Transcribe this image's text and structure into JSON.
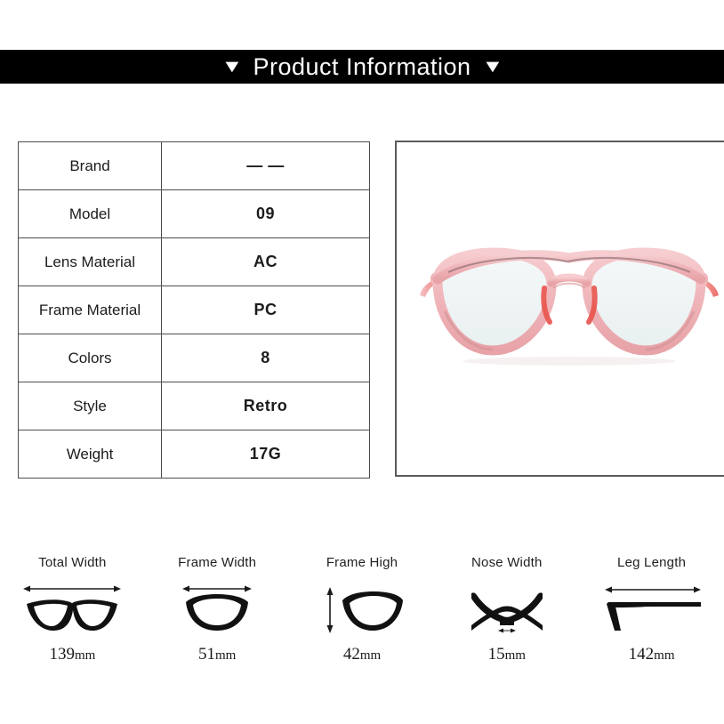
{
  "banner": {
    "title": "Product Information",
    "left_marker": "▼",
    "right_marker": "▼",
    "background_color": "#000000",
    "text_color": "#ffffff"
  },
  "spec_table": {
    "rows": [
      {
        "label": "Brand",
        "value": "— —"
      },
      {
        "label": "Model",
        "value": "09"
      },
      {
        "label": "Lens Material",
        "value": "AC"
      },
      {
        "label": "Frame Material",
        "value": "PC"
      },
      {
        "label": "Colors",
        "value": "8"
      },
      {
        "label": "Style",
        "value": "Retro"
      },
      {
        "label": "Weight",
        "value": "17G"
      }
    ]
  },
  "product_photo": {
    "alt": "pink translucent round eyeglasses",
    "frame_color": "#efb4b8",
    "frame_accent_color": "#e8534b",
    "lens_color": "#eef3f3",
    "background_color": "#ffffff",
    "border_color": "#5a5a5a"
  },
  "measurements": [
    {
      "label": "Total Width",
      "number": "139",
      "unit": "mm",
      "icon": "glasses-front-icon",
      "arrow": "horizontal"
    },
    {
      "label": "Frame Width",
      "number": "51",
      "unit": "mm",
      "icon": "single-lens-icon",
      "arrow": "horizontal"
    },
    {
      "label": "Frame High",
      "number": "42",
      "unit": "mm",
      "icon": "single-lens-height-icon",
      "arrow": "vertical"
    },
    {
      "label": "Nose Width",
      "number": "15",
      "unit": "mm",
      "icon": "nose-bridge-icon",
      "arrow": "horizontal-small"
    },
    {
      "label": "Leg Length",
      "number": "142",
      "unit": "mm",
      "icon": "temple-arm-icon",
      "arrow": "horizontal"
    }
  ]
}
